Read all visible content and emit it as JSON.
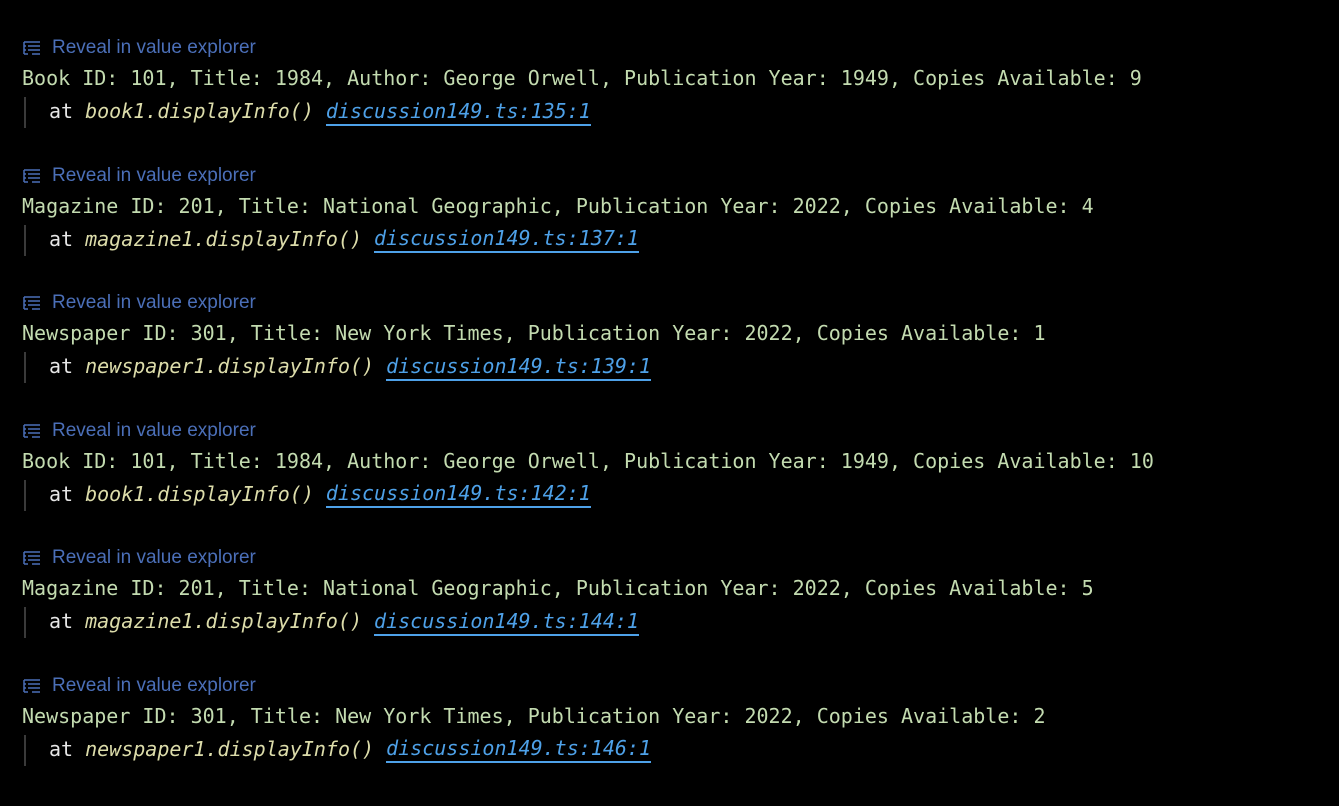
{
  "reveal_label": "Reveal in value explorer",
  "trace_prefix": "at",
  "entries": [
    {
      "message": "Book ID: 101, Title: 1984, Author: George Orwell, Publication Year: 1949, Copies Available: 9",
      "function": "book1.displayInfo()",
      "location": "discussion149.ts:135:1"
    },
    {
      "message": "Magazine ID: 201, Title: National Geographic, Publication Year: 2022, Copies Available: 4",
      "function": "magazine1.displayInfo()",
      "location": "discussion149.ts:137:1"
    },
    {
      "message": "Newspaper ID: 301, Title: New York Times, Publication Year: 2022, Copies Available: 1",
      "function": "newspaper1.displayInfo()",
      "location": "discussion149.ts:139:1"
    },
    {
      "message": "Book ID: 101, Title: 1984, Author: George Orwell, Publication Year: 1949, Copies Available: 10",
      "function": "book1.displayInfo()",
      "location": "discussion149.ts:142:1"
    },
    {
      "message": "Magazine ID: 201, Title: National Geographic, Publication Year: 2022, Copies Available: 5",
      "function": "magazine1.displayInfo()",
      "location": "discussion149.ts:144:1"
    },
    {
      "message": "Newspaper ID: 301, Title: New York Times, Publication Year: 2022, Copies Available: 2",
      "function": "newspaper1.displayInfo()",
      "location": "discussion149.ts:146:1"
    }
  ],
  "colors": {
    "background": "#000000",
    "message": "#c3dbb0",
    "reveal_link": "#4b6fb8",
    "function": "#dcdcaa",
    "location_link": "#4ea1e8"
  }
}
